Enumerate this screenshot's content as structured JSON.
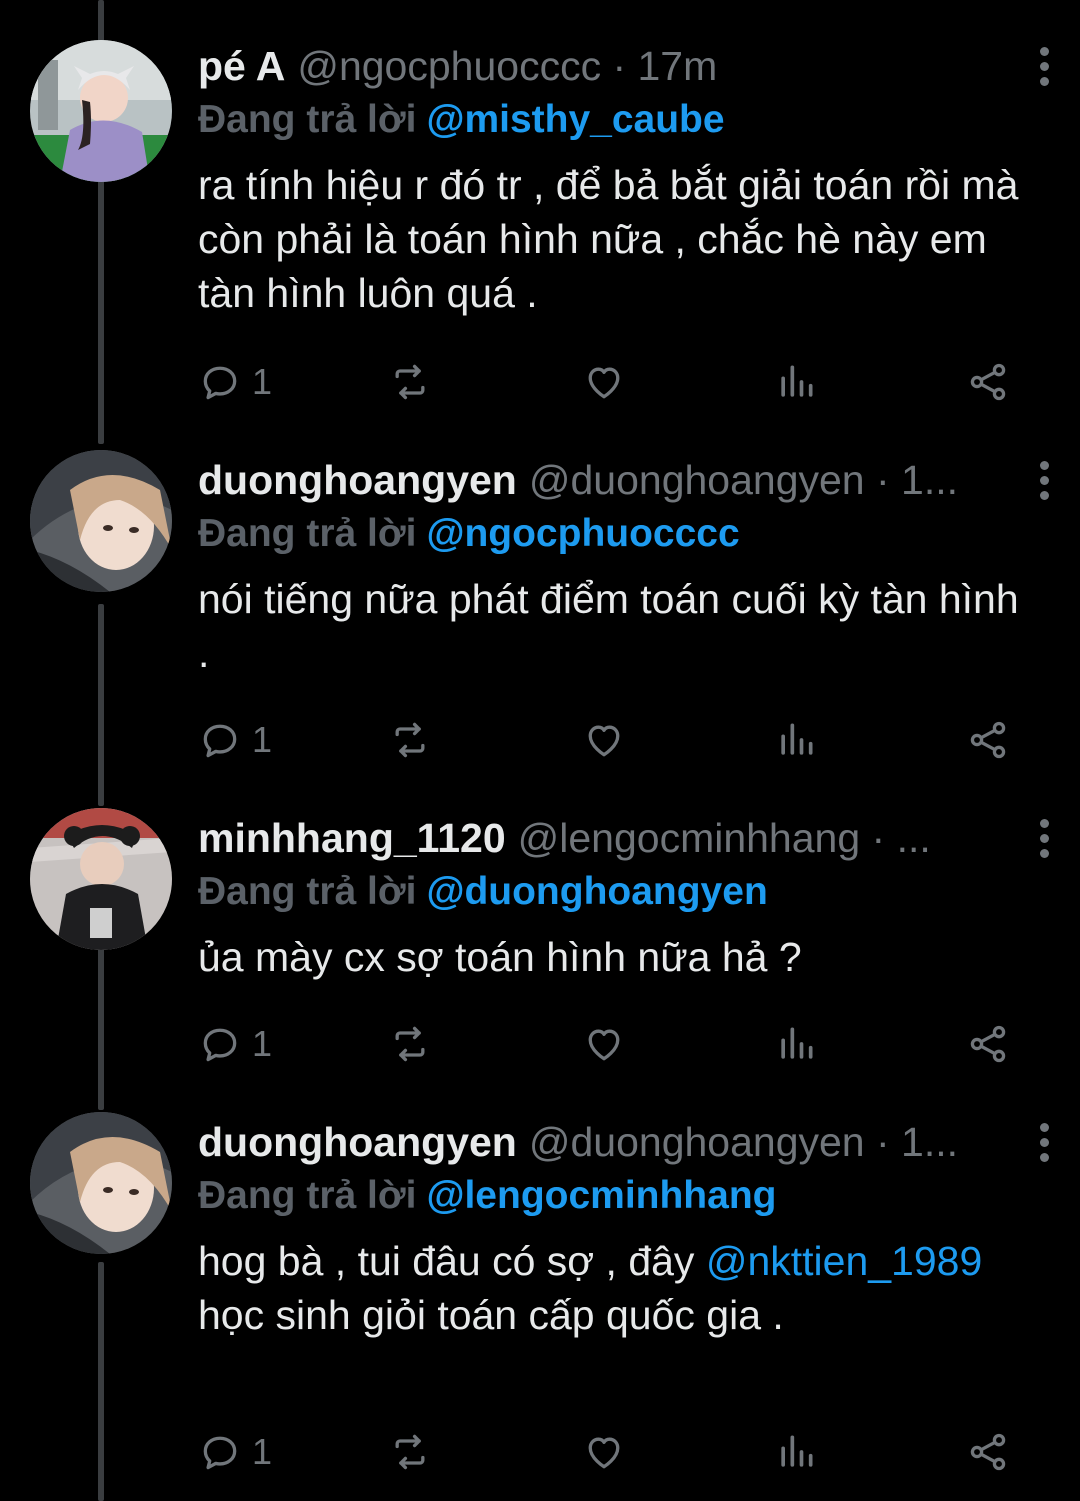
{
  "colors": {
    "background": "#000000",
    "text": "#e7e9ea",
    "muted": "#71767b",
    "link": "#1d9bf0",
    "thread_line": "#3a3d40"
  },
  "tweets": [
    {
      "display_name": "pé A",
      "handle_meta": "@ngocphuocccc · 17m",
      "replying_prefix": "Đang trả lời",
      "replying_to": "@misthy_caube",
      "text": "ra tính hiệu r đó tr , để bả bắt giải toán rồi mà còn phải là toán hình nữa , chắc hè này em tàn hình luôn quá .",
      "reply_count": "1",
      "icons": [
        "reply-icon",
        "retweet-icon",
        "like-icon",
        "views-icon",
        "share-icon",
        "more-icon"
      ]
    },
    {
      "display_name": "duonghoangyen",
      "handle_meta": "@duonghoangyen · 1...",
      "replying_prefix": "Đang trả lời",
      "replying_to": "@ngocphuocccc",
      "text": "nói tiếng nữa phát điểm toán cuối kỳ tàn hình .",
      "reply_count": "1"
    },
    {
      "display_name": "minhhang_1120",
      "handle_meta": "@lengocminhhang · ...",
      "replying_prefix": "Đang trả lời",
      "replying_to": "@duonghoangyen",
      "text": "ủa mày cx sợ toán hình nữa hả ?",
      "reply_count": "1"
    },
    {
      "display_name": "duonghoangyen",
      "handle_meta": "@duonghoangyen · 1...",
      "replying_prefix": "Đang trả lời",
      "replying_to": "@lengocminhhang",
      "text_before": "hog bà , tui đâu có sợ , đây ",
      "text_mention": "@nkttien_1989",
      "text_after": " học sinh giỏi toán cấp quốc gia .",
      "reply_count": "1"
    }
  ]
}
